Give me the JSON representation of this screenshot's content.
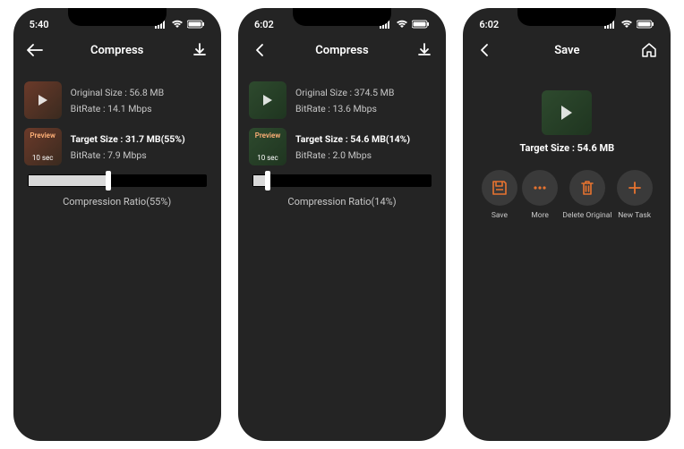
{
  "screens": [
    {
      "status_time": "5:40",
      "nav_title": "Compress",
      "back_style": "arrow-left",
      "right_icon": "download",
      "original": {
        "size_label": "Original Size : 56.8 MB",
        "bitrate_label": "BitRate : 14.1 Mbps",
        "thumb_style": "red"
      },
      "target": {
        "size_label": "Target Size : 31.7 MB(55%)",
        "bitrate_label": "BitRate : 7.9 Mbps",
        "thumb_style": "red",
        "preview_label": "Preview",
        "preview_sec": "10 sec"
      },
      "slider_pct": 45,
      "ratio_label": "Compression Ratio(55%)"
    },
    {
      "status_time": "6:02",
      "nav_title": "Compress",
      "back_style": "chevron-left",
      "right_icon": "download",
      "original": {
        "size_label": "Original Size : 374.5 MB",
        "bitrate_label": "BitRate : 13.6 Mbps",
        "thumb_style": "green"
      },
      "target": {
        "size_label": "Target Size : 54.6 MB(14%)",
        "bitrate_label": "BitRate : 2.0 Mbps",
        "thumb_style": "green",
        "preview_label": "Preview",
        "preview_sec": "10 sec"
      },
      "slider_pct": 8,
      "ratio_label": "Compression Ratio(14%)"
    },
    {
      "status_time": "6:02",
      "nav_title": "Save",
      "back_style": "chevron-left",
      "right_icon": "home",
      "save_target_label": "Target Size : 54.6 MB",
      "actions": [
        {
          "name": "save",
          "label": "Save"
        },
        {
          "name": "more",
          "label": "More"
        },
        {
          "name": "delete",
          "label": "Delete Original"
        },
        {
          "name": "new",
          "label": "New Task"
        }
      ]
    }
  ],
  "colors": {
    "accent": "#e8732f"
  }
}
